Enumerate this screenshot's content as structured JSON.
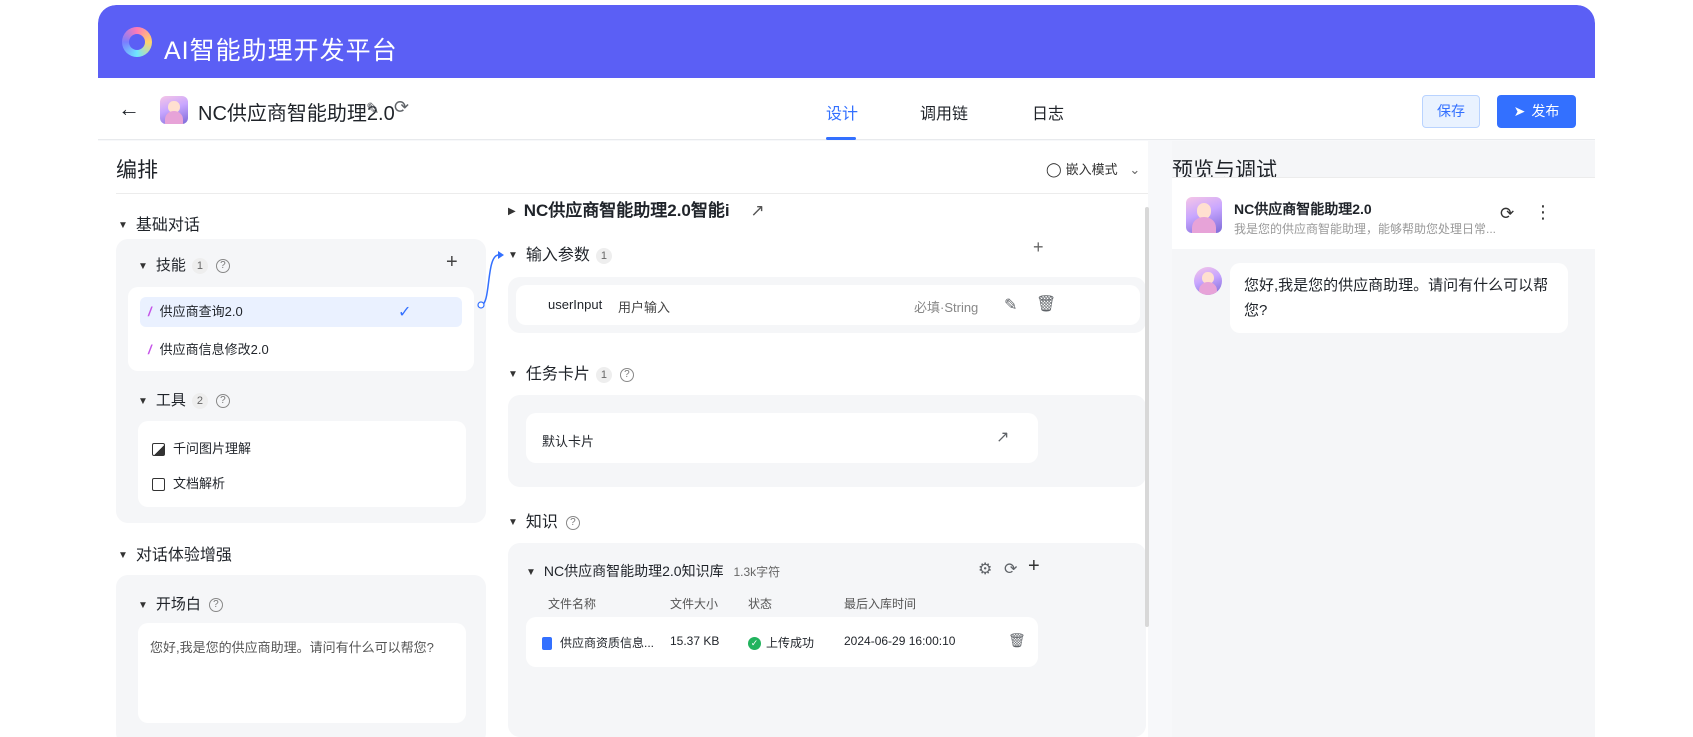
{
  "banner": {
    "title": "AI智能助理开发平台"
  },
  "header": {
    "assistant_name": "NC供应商智能助理2.0",
    "tabs": [
      {
        "label": "设计",
        "active": true
      },
      {
        "label": "调用链",
        "active": false
      },
      {
        "label": "日志",
        "active": false
      }
    ],
    "save_label": "保存",
    "publish_label": "发布"
  },
  "orchestration": {
    "title": "编排",
    "mode_label": "嵌入模式",
    "basic_dialog": {
      "title": "基础对话",
      "skills": {
        "title": "技能",
        "count": "1",
        "items": [
          {
            "label": "供应商查询2.0",
            "selected": true
          },
          {
            "label": "供应商信息修改2.0",
            "selected": false
          }
        ]
      },
      "tools": {
        "title": "工具",
        "count": "2",
        "items": [
          {
            "label": "千问图片理解",
            "icon": "image-icon"
          },
          {
            "label": "文档解析",
            "icon": "document-icon"
          }
        ]
      }
    },
    "experience": {
      "title": "对话体验增强",
      "opening": {
        "title": "开场白",
        "text": "您好,我是您的供应商助理。请问有什么可以帮您?"
      }
    },
    "flow": {
      "name": "NC供应商智能助理2.0智能i",
      "input_params": {
        "title": "输入参数",
        "count": "1",
        "param_name": "userInput",
        "param_desc": "用户输入",
        "param_type": "必填·String"
      },
      "task_cards": {
        "title": "任务卡片",
        "count": "1",
        "card_label": "默认卡片"
      },
      "knowledge": {
        "title": "知识",
        "kb_name": "NC供应商智能助理2.0知识库",
        "kb_size": "1.3k字符",
        "columns": [
          "文件名称",
          "文件大小",
          "状态",
          "最后入库时间"
        ],
        "rows": [
          {
            "name": "供应商资质信息...",
            "size": "15.37 KB",
            "status": "上传成功",
            "time": "2024-06-29 16:00:10"
          }
        ]
      }
    }
  },
  "preview": {
    "title": "预览与调试",
    "assistant_name": "NC供应商智能助理2.0",
    "assistant_desc": "我是您的供应商智能助理，能够帮助您处理日常...",
    "message": "您好,我是您的供应商助理。请问有什么可以帮您?"
  }
}
